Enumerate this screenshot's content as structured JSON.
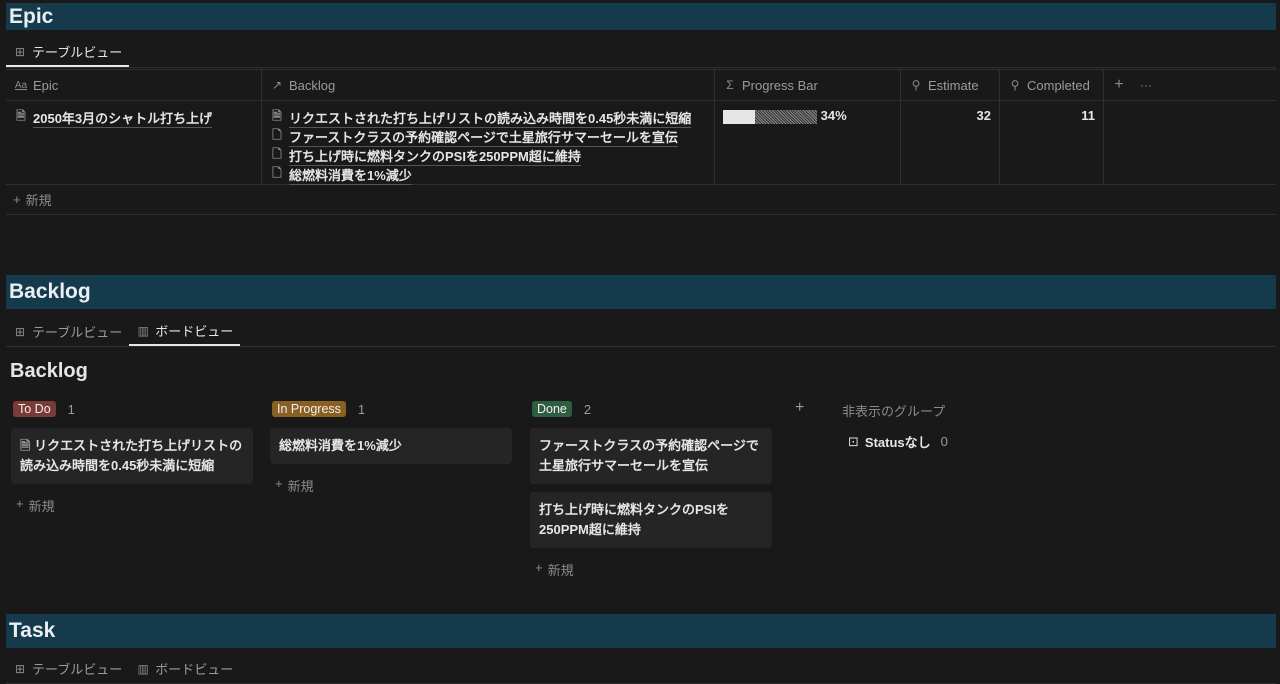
{
  "epic": {
    "title": "Epic",
    "tabs": [
      {
        "label": "テーブルビュー",
        "icon": "table-icon"
      }
    ],
    "columns": [
      {
        "label": "Epic",
        "icon": "text-icon"
      },
      {
        "label": "Backlog",
        "icon": "relation-arrow-icon"
      },
      {
        "label": "Progress Bar",
        "icon": "sigma-icon"
      },
      {
        "label": "Estimate",
        "icon": "search-icon"
      },
      {
        "label": "Completed",
        "icon": "search-icon"
      }
    ],
    "row": {
      "name": "2050年3月のシャトル打ち上げ",
      "backlog": [
        "リクエストされた打ち上げリストの読み込み時間を0.45秒未満に短縮",
        "ファーストクラスの予約確認ページで土星旅行サマーセールを宣伝",
        "打ち上げ時に燃料タンクのPSIを250PPM超に維持",
        "総燃料消費を1%減少"
      ],
      "progress_label": "34%",
      "progress": 0.34,
      "estimate": "32",
      "completed": "11"
    },
    "new_label": "新規"
  },
  "backlog": {
    "title": "Backlog",
    "tabs": [
      {
        "label": "テーブルビュー"
      },
      {
        "label": "ボードビュー"
      }
    ],
    "board_title": "Backlog",
    "groups": [
      {
        "label": "To Do",
        "count": "1",
        "color": "#7a3a36",
        "cards": [
          "リクエストされた打ち上げリストの読み込み時間を0.45秒未満に短縮"
        ]
      },
      {
        "label": "In Progress",
        "count": "1",
        "color": "#8a5f22",
        "cards": [
          "総燃料消費を1%減少"
        ]
      },
      {
        "label": "Done",
        "count": "2",
        "color": "#2d5e42",
        "cards": [
          "ファーストクラスの予約確認ページで土星旅行サマーセールを宣伝",
          "打ち上げ時に燃料タンクのPSIを250PPM超に維持"
        ]
      }
    ],
    "new_label": "新規",
    "hidden_groups": "非表示のグループ",
    "no_status": "Statusなし",
    "no_status_count": "0"
  },
  "task": {
    "title": "Task",
    "tabs": [
      {
        "label": "テーブルビュー"
      },
      {
        "label": "ボードビュー"
      }
    ]
  }
}
